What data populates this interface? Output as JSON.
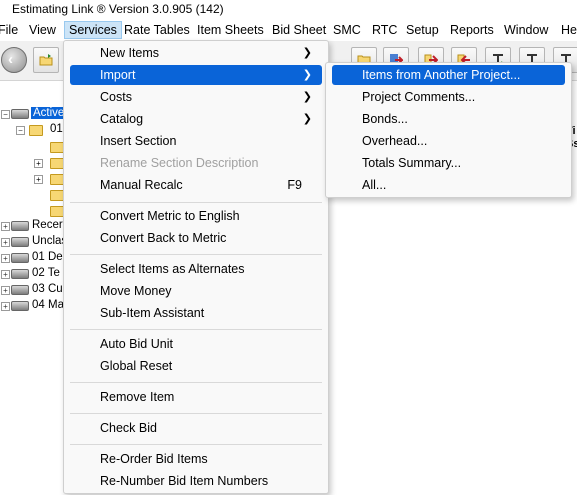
{
  "app": {
    "title": "Estimating Link ® Version   3.0.905 (142)"
  },
  "menubar": {
    "items": [
      "File",
      "View",
      "Services",
      "Rate Tables",
      "Item Sheets",
      "Bid Sheet",
      "SMC",
      "RTC",
      "Setup",
      "Reports",
      "Window",
      "He"
    ]
  },
  "tree": {
    "rows": [
      {
        "label": "Active",
        "selected": true
      },
      {
        "label": "01"
      },
      {
        "label": "Recer"
      },
      {
        "label": "Unclas"
      },
      {
        "label": "01 De"
      },
      {
        "label": "02 Te"
      },
      {
        "label": "03 Cu"
      },
      {
        "label": "04 Ma"
      }
    ]
  },
  "services_menu": {
    "items": [
      {
        "label": "New Items",
        "submenu": true
      },
      {
        "label": "Import",
        "submenu": true,
        "highlighted": true
      },
      {
        "label": "Costs",
        "submenu": true
      },
      {
        "label": "Catalog",
        "submenu": true
      },
      {
        "label": "Insert Section"
      },
      {
        "label": "Rename Section Description",
        "disabled": true
      },
      {
        "label": "Manual Recalc",
        "shortcut": "F9"
      },
      {
        "label": "Convert Metric to English"
      },
      {
        "label": "Convert Back to Metric"
      },
      {
        "label": "Select Items as Alternates"
      },
      {
        "label": "Move Money"
      },
      {
        "label": "Sub-Item Assistant"
      },
      {
        "label": "Auto Bid Unit"
      },
      {
        "label": "Global Reset"
      },
      {
        "label": "Remove Item"
      },
      {
        "label": "Check Bid"
      },
      {
        "label": "Re-Order Bid Items"
      },
      {
        "label": "Re-Number Bid Item Numbers"
      }
    ]
  },
  "import_submenu": {
    "items": [
      {
        "label": "Items from Another Project...",
        "highlighted": true
      },
      {
        "label": "Project Comments..."
      },
      {
        "label": "Bonds..."
      },
      {
        "label": "Overhead..."
      },
      {
        "label": "Totals Summary..."
      },
      {
        "label": "All..."
      }
    ]
  },
  "right_fragment": {
    "line1": "Ti",
    "line2": "Ss"
  },
  "colors": {
    "highlight": "#0a64d8",
    "menu_bg": "#f9f9f9",
    "disabled_text": "#a0a0a0"
  }
}
